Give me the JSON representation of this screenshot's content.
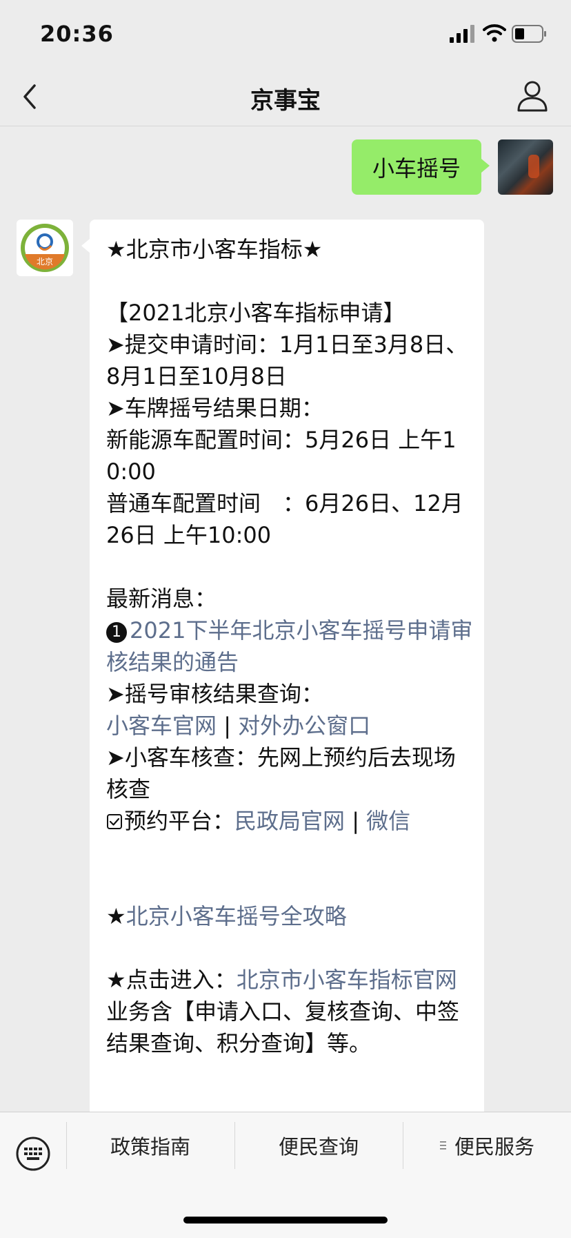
{
  "status_bar": {
    "time": "20:36",
    "icons": [
      "signal-icon",
      "wifi-icon",
      "battery-icon"
    ]
  },
  "nav": {
    "title": "京事宝",
    "back_icon": "back-icon",
    "profile_icon": "profile-icon"
  },
  "sent_message": {
    "text": "小车摇号"
  },
  "received_message": {
    "header": "★北京市小客车指标★",
    "apply_title": "【2021北京小客车指标申请】",
    "submit_time": "➤提交申请时间：1月1日至3月8日、8月1日至10月8日",
    "result_date_label": "➤车牌摇号结果日期：",
    "ev_time": "新能源车配置时间：5月26日 上午10:00",
    "normal_time": "普通车配置时间　：6月26日、12月26日 上午10:00",
    "latest_label": "最新消息：",
    "news_number": "1",
    "news_link": "2021下半年北京小客车摇号申请审核结果的通告",
    "query_label": "➤摇号审核结果查询：",
    "official_site_link": "小客车官网",
    "separator": " | ",
    "office_window_link": "对外办公窗口",
    "inspection": "➤小客车核查：先网上预约后去现场核查",
    "booking_label": "预约平台：",
    "civil_affairs_link": "民政局官网",
    "wechat_link": "微信",
    "star_prefix": "★",
    "guide_link": "北京小客车摇号全攻略",
    "enter_prefix": "★点击进入：",
    "official_index_link": "北京市小客车指标官网",
    "business": "业务含【申请入口、复核查询、中签结果查询、积分查询】等。"
  },
  "bottom_menu": {
    "keyboard_icon": "keyboard-icon",
    "items": [
      {
        "label": "政策指南"
      },
      {
        "label": "便民查询"
      },
      {
        "label": "便民服务",
        "icon": "menu-lines-icon"
      }
    ]
  },
  "colors": {
    "sent_bubble": "#95ec69",
    "link": "#5d6e8c",
    "background": "#ececec"
  }
}
